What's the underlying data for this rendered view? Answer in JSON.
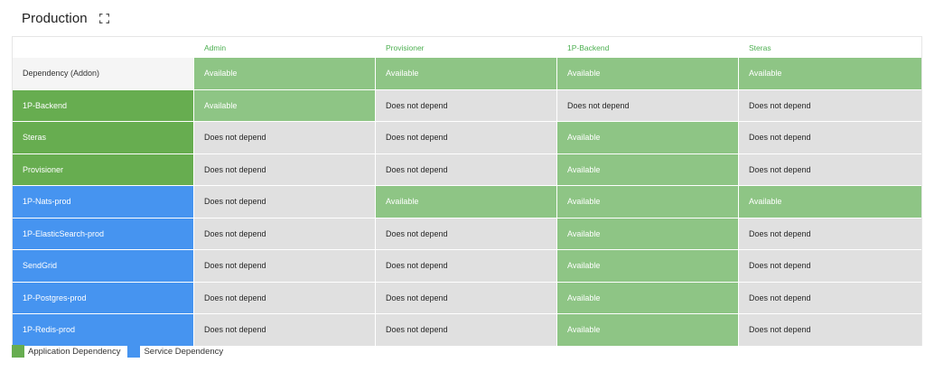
{
  "header": {
    "title": "Production",
    "expand_icon": "fullscreen-icon"
  },
  "colors": {
    "application_dependency": "#67ad50",
    "service_dependency": "#4694f0",
    "available": "#8ec585",
    "does_not_depend": "#e0e0e0",
    "column_header_text": "#4caf50"
  },
  "table": {
    "columns": [
      "",
      "Admin",
      "Provisioner",
      "1P-Backend",
      "Steras"
    ],
    "rows": [
      {
        "label": "Dependency (Addon)",
        "kind": "addon",
        "cells": [
          "Available",
          "Available",
          "Available",
          "Available"
        ]
      },
      {
        "label": "1P-Backend",
        "kind": "app",
        "cells": [
          "Available",
          "Does not depend",
          "Does not depend",
          "Does not depend"
        ]
      },
      {
        "label": "Steras",
        "kind": "app",
        "cells": [
          "Does not depend",
          "Does not depend",
          "Available",
          "Does not depend"
        ]
      },
      {
        "label": "Provisioner",
        "kind": "app",
        "cells": [
          "Does not depend",
          "Does not depend",
          "Available",
          "Does not depend"
        ]
      },
      {
        "label": "1P-Nats-prod",
        "kind": "svc",
        "cells": [
          "Does not depend",
          "Available",
          "Available",
          "Available"
        ]
      },
      {
        "label": "1P-ElasticSearch-prod",
        "kind": "svc",
        "cells": [
          "Does not depend",
          "Does not depend",
          "Available",
          "Does not depend"
        ]
      },
      {
        "label": "SendGrid",
        "kind": "svc",
        "cells": [
          "Does not depend",
          "Does not depend",
          "Available",
          "Does not depend"
        ]
      },
      {
        "label": "1P-Postgres-prod",
        "kind": "svc",
        "cells": [
          "Does not depend",
          "Does not depend",
          "Available",
          "Does not depend"
        ]
      },
      {
        "label": "1P-Redis-prod",
        "kind": "svc",
        "cells": [
          "Does not depend",
          "Does not depend",
          "Available",
          "Does not depend"
        ]
      }
    ]
  },
  "legend": [
    {
      "label": "Application Dependency",
      "color": "#67ad50"
    },
    {
      "label": "Service Dependency",
      "color": "#4694f0"
    }
  ]
}
